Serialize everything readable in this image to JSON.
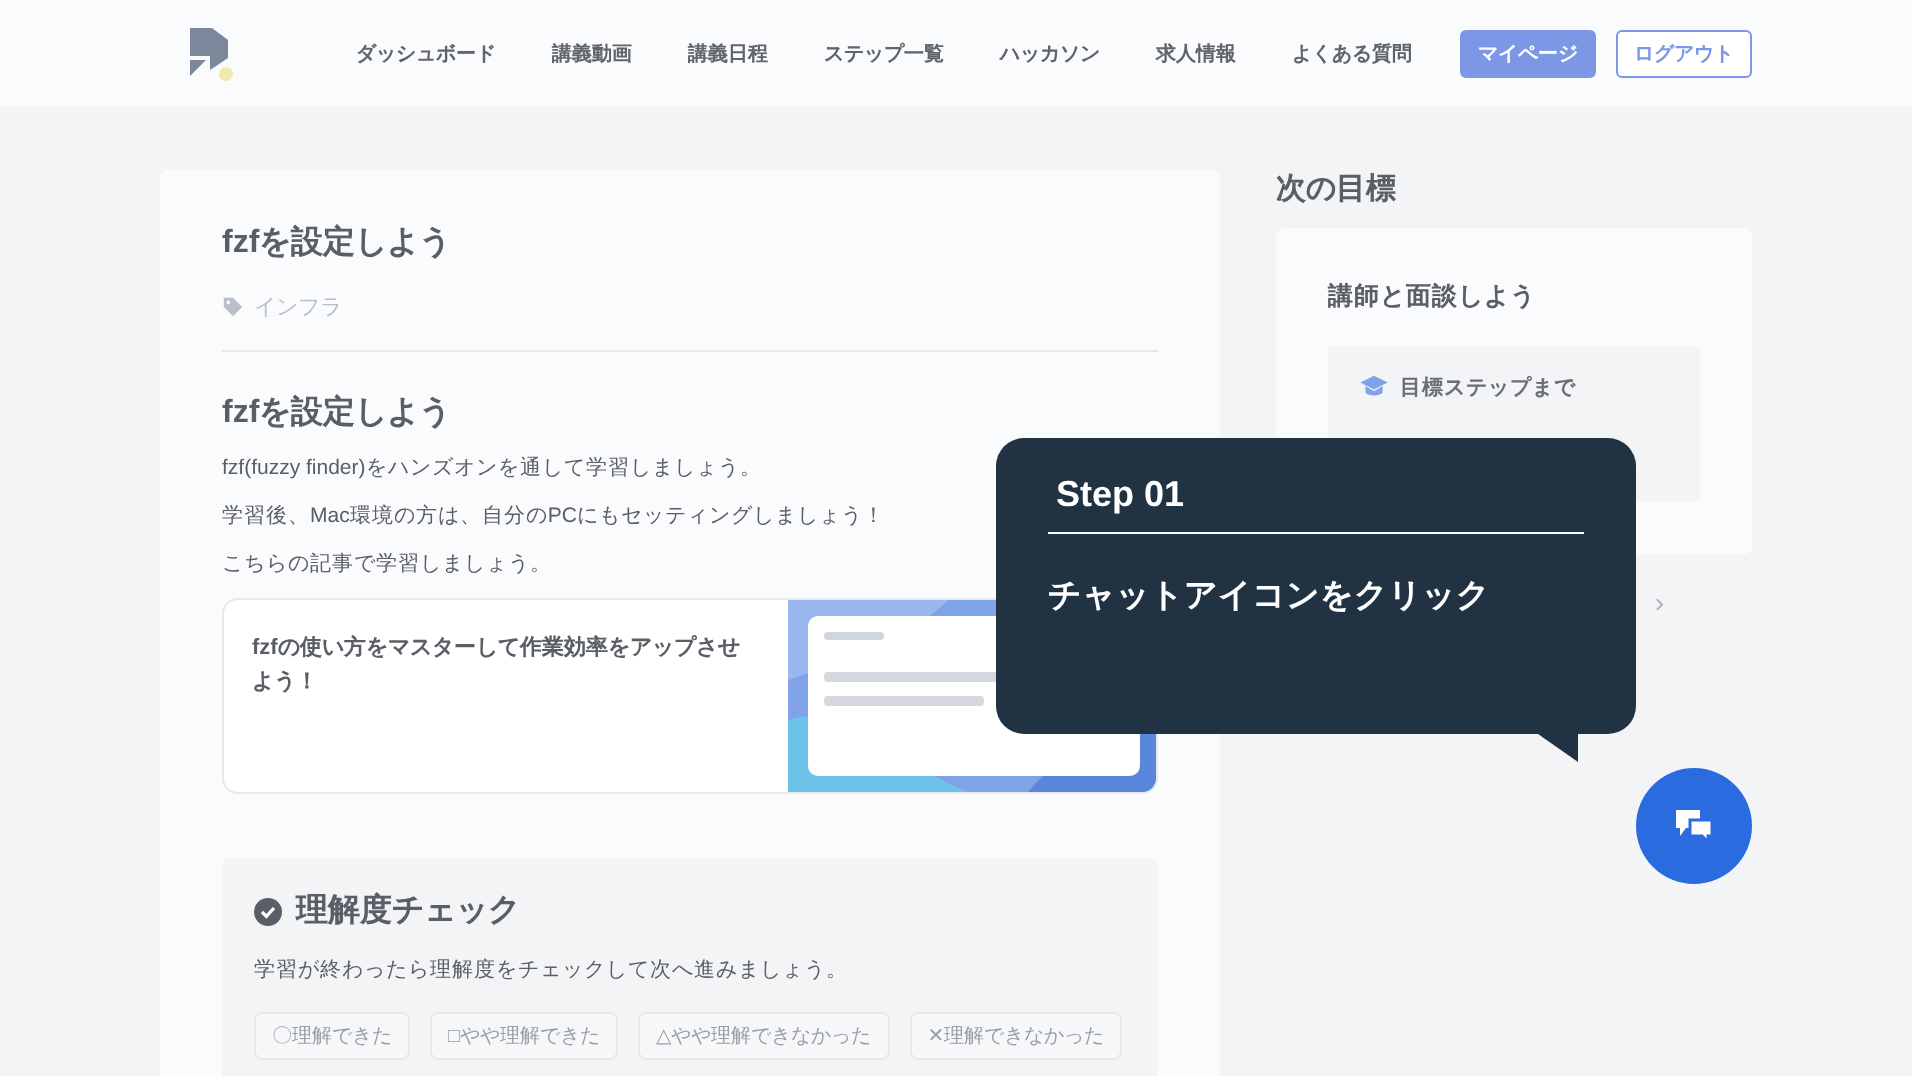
{
  "nav": {
    "items": [
      {
        "label": "ダッシュボード"
      },
      {
        "label": "講義動画"
      },
      {
        "label": "講義日程"
      },
      {
        "label": "ステップ一覧"
      },
      {
        "label": "ハッカソン"
      },
      {
        "label": "求人情報"
      },
      {
        "label": "よくある質問"
      }
    ],
    "buttons": [
      {
        "label": "マイページ",
        "kind": "primary"
      },
      {
        "label": "ログアウト",
        "kind": "outline"
      }
    ]
  },
  "article": {
    "title": "fzfを設定しよう",
    "tag": "インフラ",
    "heading": "fzfを設定しよう",
    "paragraphs": [
      "fzf(fuzzy finder)をハンズオンを通して学習しましょう。",
      "学習後、Mac環境の方は、自分のPCにもセッティングしましょう！",
      "こちらの記事で学習しましょう。"
    ],
    "link_card": {
      "title": "fzfの使い方をマスターして作業効率をアップさせよう！"
    }
  },
  "check": {
    "title": "理解度チェック",
    "description": "学習が終わったら理解度をチェックして次へ進みましょう。",
    "options": [
      {
        "label": "〇理解できた"
      },
      {
        "label": "□やや理解できた"
      },
      {
        "label": "△やや理解できなかった"
      },
      {
        "label": "✕理解できなかった"
      }
    ]
  },
  "next_goal": {
    "heading": "次の目標",
    "title": "講師と面談しよう",
    "progress_label": "目標ステップまで",
    "chevron": "›"
  },
  "tooltip": {
    "step": "Step 01",
    "message": "チャットアイコンをクリック"
  }
}
